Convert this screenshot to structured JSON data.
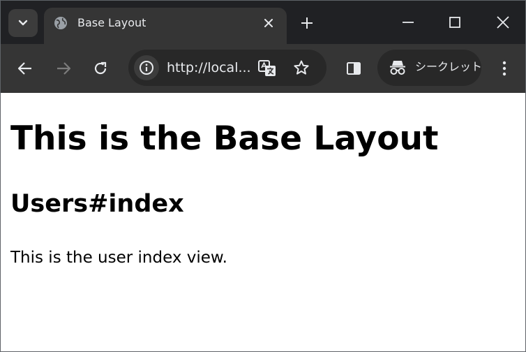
{
  "browser": {
    "tab": {
      "title": "Base Layout"
    },
    "omnibox": {
      "url": "http://local..."
    },
    "incognito": {
      "label": "シークレット"
    }
  },
  "page": {
    "heading1": "This is the Base Layout",
    "heading2": "Users#index",
    "paragraph": "This is the user index view."
  },
  "colors": {
    "tabstrip_bg": "#202124",
    "toolbar_bg": "#353535",
    "omnibox_bg": "#282828",
    "icon_fg": "#e8eaed",
    "icon_disabled": "#7c7c7c"
  }
}
